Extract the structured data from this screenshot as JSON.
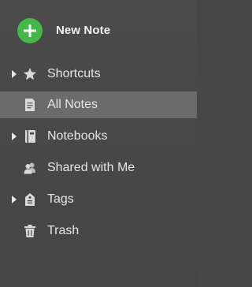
{
  "new_note": {
    "label": "New Note",
    "icon": "plus-icon",
    "accent": "#45b649"
  },
  "sidebar": {
    "items": [
      {
        "label": "Shortcuts",
        "icon": "star-icon",
        "expandable": true,
        "selected": false
      },
      {
        "label": "All Notes",
        "icon": "note-icon",
        "expandable": false,
        "selected": true
      },
      {
        "label": "Notebooks",
        "icon": "notebook-icon",
        "expandable": true,
        "selected": false
      },
      {
        "label": "Shared with Me",
        "icon": "people-icon",
        "expandable": false,
        "selected": false
      },
      {
        "label": "Tags",
        "icon": "tag-icon",
        "expandable": true,
        "selected": false
      },
      {
        "label": "Trash",
        "icon": "trash-icon",
        "expandable": false,
        "selected": false
      }
    ]
  },
  "colors": {
    "background": "#474747",
    "selected_row": "#6b6b6b",
    "text": "#e6e6e6",
    "icon": "#d9d9d9"
  }
}
